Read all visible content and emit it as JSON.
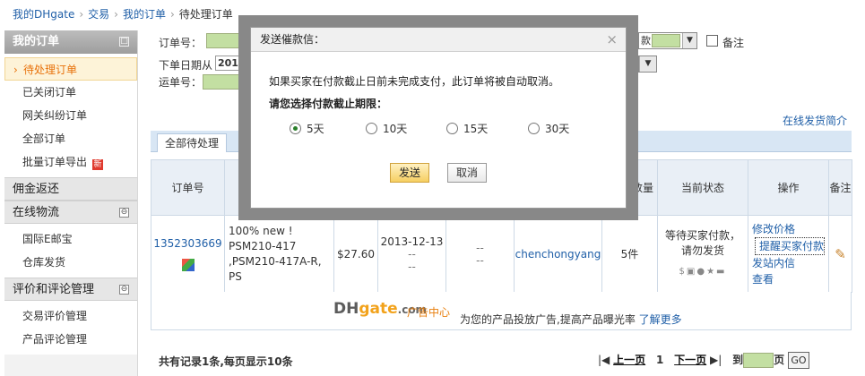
{
  "breadcrumb": [
    "我的DHgate",
    "交易",
    "我的订单",
    "待处理订单"
  ],
  "sidebar": {
    "sections": [
      {
        "title": "我的订单",
        "toggle": "□",
        "items": [
          "待处理订单",
          "已关闭订单",
          "网关纠纷订单",
          "全部订单",
          "批量订单导出"
        ]
      },
      {
        "title": "佣金返还"
      },
      {
        "title": "在线物流",
        "toggle": "⊖",
        "items": [
          "国际E邮宝",
          "仓库发货"
        ]
      },
      {
        "title": "评价和评论管理",
        "toggle": "⊖",
        "items": [
          "交易评价管理",
          "产品评论管理"
        ]
      }
    ],
    "badge": "新"
  },
  "search": {
    "order_no_label": "订单号：",
    "date_label": "下单日期从",
    "date_value": "201",
    "tracking_label": "运单号：",
    "select_suffix": "款",
    "remark_label": "备注"
  },
  "right_link": "在线发货简介",
  "tabs": [
    "全部待处理"
  ],
  "table": {
    "headers": [
      "订单号",
      "",
      "",
      "",
      "",
      "",
      "产品数量",
      "当前状态",
      "操作",
      "备注"
    ],
    "row": {
      "order_no": "1352303669",
      "product": "100% new ! PSM210-417 ,PSM210-417A-R, PS",
      "price": "$27.60",
      "date": "2013-12-13",
      "dash": "--",
      "buyer": "chenchongyang",
      "qty": "5件",
      "status": "等待买家付款，请勿发货",
      "actions": [
        "修改价格",
        "提醒买家付款",
        "发站内信",
        "查看"
      ]
    }
  },
  "ad": {
    "logo_dh": "DH",
    "logo_gate": "gate",
    "logo_com": ".com",
    "tag": "广告中心",
    "text": "为您的产品投放广告,提高产品曝光率",
    "link": "了解更多"
  },
  "footer": {
    "summary": "共有记录1条,每页显示10条",
    "first": "|◀",
    "prev": "上一页",
    "page": "1",
    "next": "下一页",
    "last": "▶|",
    "goto_label": "到",
    "goto_suffix": "页",
    "go": "GO"
  },
  "dialog": {
    "title": "发送催款信：",
    "close": "×",
    "message": "如果买家在付款截止日前未完成支付，此订单将被自动取消。",
    "question": "请您选择付款截止期限：",
    "options": [
      "5天",
      "10天",
      "15天",
      "30天"
    ],
    "selected": "5天",
    "send": "发送",
    "cancel": "取消"
  }
}
